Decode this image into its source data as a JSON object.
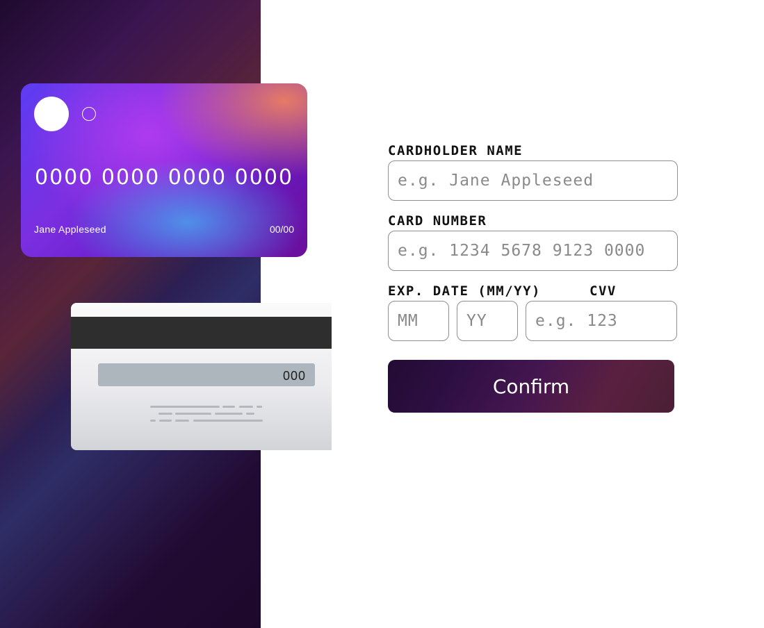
{
  "card_front": {
    "number": "0000 0000 0000 0000",
    "name": "Jane Appleseed",
    "expiry": "00/00"
  },
  "card_back": {
    "cvv": "000"
  },
  "form": {
    "cardholder_label": "CARDHOLDER NAME",
    "cardholder_placeholder": "e.g. Jane Appleseed",
    "cardholder_value": "",
    "number_label": "CARD NUMBER",
    "number_placeholder": "e.g. 1234 5678 9123 0000",
    "number_value": "",
    "exp_label": "EXP. DATE (MM/YY)",
    "month_placeholder": "MM",
    "year_placeholder": "YY",
    "cvv_label": "CVV",
    "cvv_placeholder": "e.g. 123",
    "confirm_label": "Confirm"
  },
  "colors": {
    "accent_dark": "#220b33",
    "input_border": "#8e8e8e",
    "placeholder": "#8a8a8a"
  }
}
